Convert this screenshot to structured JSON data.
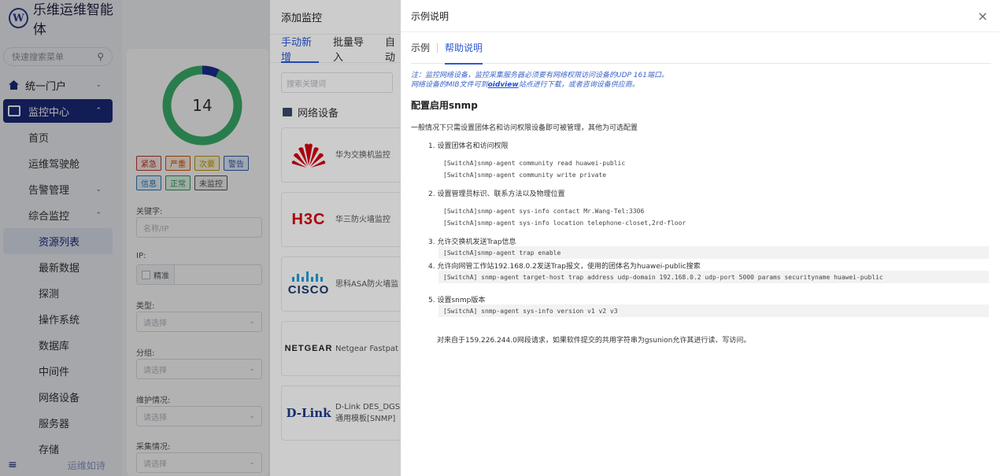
{
  "sidebar": {
    "brand_logo_letter": "W",
    "brand_title": "乐维运维智能体",
    "search_placeholder": "快速搜索菜单",
    "items": {
      "portal": "统一门户",
      "monitor_center": "监控中心",
      "home": "首页",
      "cockpit": "运维驾驶舱",
      "alarm": "告警管理",
      "general_monitor": "综合监控",
      "resource_list": "资源列表",
      "latest_data": "最新数据",
      "probe": "探测",
      "os": "操作系统",
      "database": "数据库",
      "middleware": "中间件",
      "network_device": "网络设备",
      "server": "服务器",
      "storage": "存储"
    },
    "footer_text": "运维如诗"
  },
  "filter": {
    "ring_total": "14",
    "ring_fraction_blue": 0.07,
    "tags": [
      {
        "label": "紧急",
        "color": "#c0392b",
        "bg": "#fdecea"
      },
      {
        "label": "严重",
        "color": "#d35400",
        "bg": "#fdf0e6"
      },
      {
        "label": "次要",
        "color": "#c49a00",
        "bg": "#fdf8e1"
      },
      {
        "label": "警告",
        "color": "#2e5fb3",
        "bg": "#e8eefb"
      },
      {
        "label": "信息",
        "color": "#2c7fb8",
        "bg": "#e7f3fb"
      },
      {
        "label": "正常",
        "color": "#2a9d5c",
        "bg": "#e6f6ec"
      },
      {
        "label": "未监控",
        "color": "#555555",
        "bg": "#f2f2f2"
      }
    ],
    "keyword_label": "关键字:",
    "keyword_placeholder": "名称/IP",
    "ip_label": "IP:",
    "ip_exact": "精准",
    "type_label": "类型:",
    "type_placeholder": "请选择",
    "group_label": "分组:",
    "group_placeholder": "请选择",
    "maint_label": "维护情况:",
    "maint_placeholder": "请选择",
    "collect_label": "采集情况:",
    "collect_placeholder": "请选择"
  },
  "add_panel": {
    "title": "添加监控",
    "tabs": [
      "手动新增",
      "批量导入",
      "自动"
    ],
    "search_placeholder": "搜索关键词",
    "section_title": "网络设备",
    "devices": [
      {
        "logo": "HUAWEI",
        "name": "华为交换机监控"
      },
      {
        "logo": "H3C",
        "name": "华三防火墙监控"
      },
      {
        "logo": "CISCO",
        "name": "思科ASA防火墙监"
      },
      {
        "logo": "NETGEAR",
        "name": "Netgear Fastpat"
      },
      {
        "logo": "D-Link",
        "name": "D-Link DES_DGS",
        "name2": "通用模板[SNMP]"
      }
    ]
  },
  "drawer": {
    "title": "示例说明",
    "close": "×",
    "tabs": [
      "示例",
      "帮助说明"
    ],
    "note_line1": "注：监控网络设备，监控采集服务器必须要有网络权限访问设备的UDP 161端口。",
    "note_line2_pre": "网络设备的MIB文件可到",
    "note_link": "oidview",
    "note_line2_post": "站点进行下载，或者咨询设备供应商。",
    "heading": "配置启用snmp",
    "intro": "一般情况下只需设置团体名和访问权限设备即可被管理，其他为可选配置",
    "step1": "1. 设置团体名和访问权限",
    "step1_code": [
      "[SwitchA]snmp-agent community read huawei-public",
      "[SwitchA]snmp-agent community write private"
    ],
    "step2": "2. 设置管理员标识、联系方法以及物理位置",
    "step2_code": [
      "[SwitchA]snmp-agent sys-info contact Mr.Wang-Tel:3306",
      "[SwitchA]snmp-agent sys-info location telephone-closet,2rd-floor"
    ],
    "step3": "3. 允许交换机发送Trap信息",
    "step3_code": "[SwitchA]snmp-agent trap enable",
    "step4": "4. 允许向网管工作站192.168.0.2发送Trap报文，使用的团体名为huawei-public搜索",
    "step4_code": "[SwitchA] snmp-agent target-host trap address udp-domain 192.168.0.2 udp-port 5000 params securityname huawei-public",
    "step5": "5. 设置snmp版本",
    "step5_code": "[SwitchA] snmp-agent sys-info version v1 v2 v3",
    "tail": "对来自于159.226.244.0网段请求，如果软件提交的共用字符串为gsunion允许其进行读、写访问。"
  }
}
